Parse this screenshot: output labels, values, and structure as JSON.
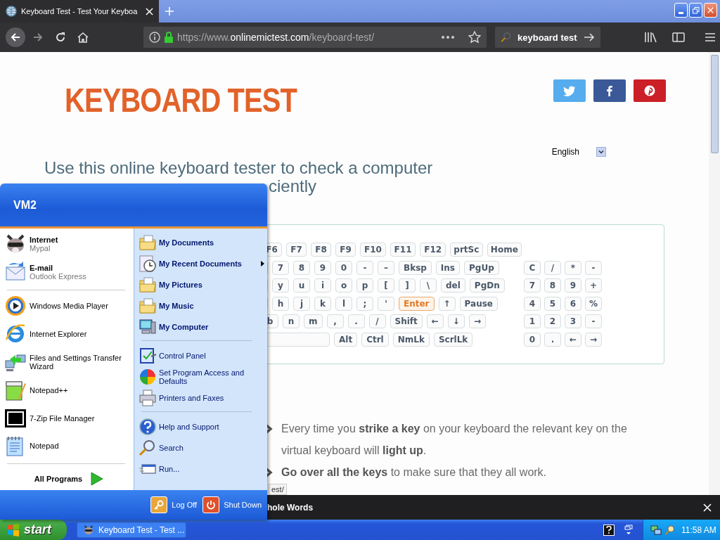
{
  "browser": {
    "tabs": [
      {
        "title": "Keyboard Test - Test Your Keyboa",
        "selected": true
      }
    ],
    "address": "https://www.**onlinemictest.com**/keyboard-test/",
    "search": {
      "value": "keyboard test"
    }
  },
  "page": {
    "title": "KEYBOARD TEST",
    "language": "English",
    "intro_lines": [
      "Use this online keyboard tester to check a computer",
      "ciently"
    ],
    "keyboard": {
      "rows": [
        {
          "main": [
            {
              "kind": "key",
              "label": "F6",
              "lit": false
            },
            {
              "kind": "key",
              "label": "F7",
              "lit": false
            },
            {
              "kind": "key",
              "label": "F8",
              "lit": false
            },
            {
              "kind": "key",
              "label": "F9",
              "lit": false
            },
            {
              "kind": "key",
              "label": "F10",
              "lit": false
            },
            {
              "kind": "key",
              "label": "F11",
              "lit": false
            },
            {
              "kind": "key",
              "label": "F12",
              "lit": false
            },
            {
              "kind": "key",
              "label": "prtSc",
              "lit": false
            },
            {
              "kind": "key",
              "label": "Home",
              "lit": false
            }
          ],
          "numpad": []
        },
        {
          "main": [
            {
              "kind": "stub",
              "lit": false
            },
            {
              "kind": "key",
              "label": "7",
              "lit": false
            },
            {
              "kind": "key",
              "label": "8",
              "lit": false
            },
            {
              "kind": "key",
              "label": "9",
              "lit": false
            },
            {
              "kind": "key",
              "label": "0",
              "lit": false
            },
            {
              "kind": "key",
              "label": "-",
              "lit": false
            },
            {
              "kind": "key",
              "label": "–",
              "lit": false
            },
            {
              "kind": "key",
              "label": "Bksp",
              "lit": false
            },
            {
              "kind": "key",
              "label": "Ins",
              "lit": false
            },
            {
              "kind": "key",
              "label": "PgUp",
              "lit": false
            }
          ],
          "numpad": [
            {
              "kind": "key",
              "label": "C",
              "lit": false
            },
            {
              "kind": "key",
              "label": "/",
              "lit": false
            },
            {
              "kind": "key",
              "label": "*",
              "lit": false
            },
            {
              "kind": "key",
              "label": "-",
              "lit": false
            }
          ]
        },
        {
          "main": [
            {
              "kind": "stub",
              "lit": false
            },
            {
              "kind": "key",
              "label": "y",
              "lit": false
            },
            {
              "kind": "key",
              "label": "u",
              "lit": false
            },
            {
              "kind": "key",
              "label": "i",
              "lit": false
            },
            {
              "kind": "key",
              "label": "o",
              "lit": false
            },
            {
              "kind": "key",
              "label": "p",
              "lit": false
            },
            {
              "kind": "key",
              "label": "[",
              "lit": false
            },
            {
              "kind": "key",
              "label": "]",
              "lit": false
            },
            {
              "kind": "key",
              "label": "\\",
              "lit": false
            },
            {
              "kind": "key",
              "label": "del",
              "lit": false
            },
            {
              "kind": "key",
              "label": "PgDn",
              "lit": false
            }
          ],
          "numpad": [
            {
              "kind": "key",
              "label": "7",
              "lit": false
            },
            {
              "kind": "key",
              "label": "8",
              "lit": false
            },
            {
              "kind": "key",
              "label": "9",
              "lit": false
            },
            {
              "kind": "key",
              "label": "+",
              "lit": false
            }
          ]
        },
        {
          "main": [
            {
              "kind": "stub",
              "lit": false
            },
            {
              "kind": "key",
              "label": "h",
              "lit": false
            },
            {
              "kind": "key",
              "label": "j",
              "lit": false
            },
            {
              "kind": "key",
              "label": "k",
              "lit": false
            },
            {
              "kind": "key",
              "label": "l",
              "lit": false
            },
            {
              "kind": "key",
              "label": ";",
              "lit": false
            },
            {
              "kind": "key",
              "label": "'",
              "lit": false
            },
            {
              "kind": "key",
              "label": "Enter",
              "lit": true
            },
            {
              "kind": "key",
              "label": "↑",
              "lit": false
            },
            {
              "kind": "key",
              "label": "Pause",
              "lit": false
            }
          ],
          "numpad": [
            {
              "kind": "key",
              "label": "4",
              "lit": false
            },
            {
              "kind": "key",
              "label": "5",
              "lit": false
            },
            {
              "kind": "key",
              "label": "6",
              "lit": false
            },
            {
              "kind": "key",
              "label": "%",
              "lit": false
            }
          ]
        },
        {
          "main": [
            {
              "kind": "key",
              "label": "b",
              "lit": false
            },
            {
              "kind": "key",
              "label": "n",
              "lit": false
            },
            {
              "kind": "key",
              "label": "m",
              "lit": false
            },
            {
              "kind": "key",
              "label": ",",
              "lit": false
            },
            {
              "kind": "key",
              "label": ".",
              "lit": false
            },
            {
              "kind": "key",
              "label": "/",
              "lit": false
            },
            {
              "kind": "key",
              "label": "Shift",
              "lit": false
            },
            {
              "kind": "key",
              "label": "←",
              "lit": false
            },
            {
              "kind": "key",
              "label": "↓",
              "lit": false
            },
            {
              "kind": "key",
              "label": "→",
              "lit": false
            }
          ],
          "numpad": [
            {
              "kind": "key",
              "label": "1",
              "lit": false
            },
            {
              "kind": "key",
              "label": "2",
              "lit": false
            },
            {
              "kind": "key",
              "label": "3",
              "lit": false
            },
            {
              "kind": "key",
              "label": "-",
              "lit": false
            }
          ]
        },
        {
          "main": [
            {
              "kind": "space",
              "lit": false
            },
            {
              "kind": "key",
              "label": "Alt",
              "lit": false
            },
            {
              "kind": "key",
              "label": "Ctrl",
              "lit": false
            },
            {
              "kind": "key",
              "label": "NmLk",
              "lit": false
            },
            {
              "kind": "key",
              "label": "ScrlLk",
              "lit": false
            }
          ],
          "numpad": [
            {
              "kind": "key",
              "label": "0",
              "lit": false
            },
            {
              "kind": "key",
              "label": ".",
              "lit": false
            },
            {
              "kind": "key",
              "label": "←",
              "lit": false
            },
            {
              "kind": "key",
              "label": "→",
              "lit": false
            }
          ]
        }
      ]
    },
    "tips": [
      "Every time you **strike a key** on your keyboard the relevant key on the virtual keyboard will **light up**.",
      "**Go over all the keys** to make sure that they all work."
    ],
    "status_link": "est/"
  },
  "find_bar": {
    "label": "hole Words"
  },
  "start_menu": {
    "user": "VM2",
    "pinned": [
      {
        "title": "Internet",
        "subtitle": "Mypal"
      },
      {
        "title": "E-mail",
        "subtitle": "Outlook Express"
      }
    ],
    "recent": [
      "Windows Media Player",
      "Internet Explorer",
      "Files and Settings Transfer Wizard",
      "Notepad++",
      "7-Zip File Manager",
      "Notepad"
    ],
    "all_programs": "All Programs",
    "places": [
      {
        "label": "My Documents",
        "submenu": false
      },
      {
        "label": "My Recent Documents",
        "submenu": true
      },
      {
        "label": "My Pictures",
        "submenu": false
      },
      {
        "label": "My Music",
        "submenu": false
      },
      {
        "label": "My Computer",
        "submenu": false
      }
    ],
    "system": [
      "Control Panel",
      "Set Program Access and Defaults",
      "Printers and Faxes"
    ],
    "help": [
      "Help and Support",
      "Search",
      "Run..."
    ],
    "log_off": "Log Off",
    "shut_down": "Shut Down"
  },
  "taskbar": {
    "start": "start",
    "tasks": [
      {
        "label": "Keyboard Test - Test ...",
        "selected": false
      }
    ],
    "clock": "11:58 AM"
  }
}
